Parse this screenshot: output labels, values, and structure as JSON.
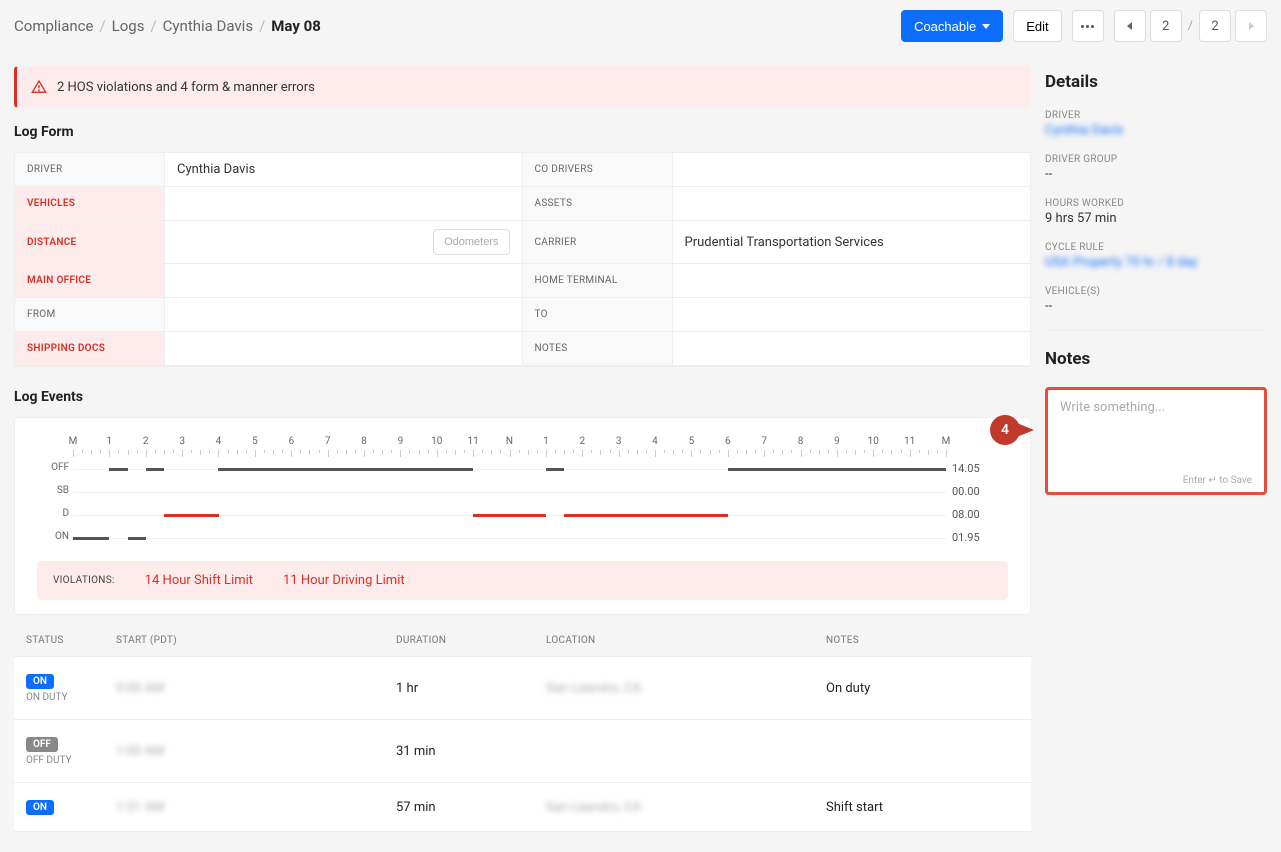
{
  "breadcrumbs": [
    "Compliance",
    "Logs",
    "Cynthia Davis",
    "May 08"
  ],
  "top_actions": {
    "primary": "Coachable",
    "edit": "Edit",
    "page_current": "2",
    "page_total": "2"
  },
  "alert": "2 HOS violations and 4 form & manner errors",
  "sections": {
    "log_form": "Log Form",
    "log_events": "Log Events"
  },
  "form": {
    "rows": [
      {
        "l": "DRIVER",
        "lv": "Cynthia Davis",
        "le": false,
        "r": "CO DRIVERS",
        "rv": "",
        "re": false
      },
      {
        "l": "VEHICLES",
        "lv": "",
        "le": true,
        "r": "ASSETS",
        "rv": "",
        "re": false
      },
      {
        "l": "DISTANCE",
        "lv": "",
        "le": true,
        "odo": "Odometers",
        "r": "CARRIER",
        "rv": "Prudential Transportation Services",
        "re": false
      },
      {
        "l": "MAIN OFFICE",
        "lv": "",
        "le": true,
        "r": "HOME TERMINAL",
        "rv": "",
        "re": false
      },
      {
        "l": "FROM",
        "lv": "",
        "le": false,
        "r": "TO",
        "rv": "",
        "re": false
      },
      {
        "l": "SHIPPING DOCS",
        "lv": "",
        "le": true,
        "r": "NOTES",
        "rv": "",
        "re": false
      }
    ]
  },
  "chart_data": {
    "type": "line",
    "x_labels": [
      "M",
      "1",
      "2",
      "3",
      "4",
      "5",
      "6",
      "7",
      "8",
      "9",
      "10",
      "11",
      "N",
      "1",
      "2",
      "3",
      "4",
      "5",
      "6",
      "7",
      "8",
      "9",
      "10",
      "11",
      "M"
    ],
    "rows": [
      "OFF",
      "SB",
      "D",
      "ON"
    ],
    "totals": {
      "OFF": "14.05",
      "SB": "00.00",
      "D": "08.00",
      "ON": "01.95"
    },
    "segments": [
      {
        "status": "ON",
        "start": 0.0,
        "end": 1.0,
        "color": "gray"
      },
      {
        "status": "OFF",
        "start": 1.0,
        "end": 1.5,
        "color": "gray"
      },
      {
        "status": "ON",
        "start": 1.5,
        "end": 2.0,
        "color": "gray"
      },
      {
        "status": "OFF",
        "start": 2.0,
        "end": 2.5,
        "color": "gray"
      },
      {
        "status": "D",
        "start": 2.5,
        "end": 4.0,
        "color": "red"
      },
      {
        "status": "OFF",
        "start": 4.0,
        "end": 11.0,
        "color": "gray"
      },
      {
        "status": "D",
        "start": 11.0,
        "end": 13.0,
        "color": "red"
      },
      {
        "status": "OFF",
        "start": 13.0,
        "end": 13.5,
        "color": "gray"
      },
      {
        "status": "D",
        "start": 13.5,
        "end": 18.0,
        "color": "red"
      },
      {
        "status": "OFF",
        "start": 18.0,
        "end": 24.0,
        "color": "gray"
      }
    ]
  },
  "violations": {
    "label": "VIOLATIONS:",
    "items": [
      "14 Hour Shift Limit",
      "11 Hour Driving Limit"
    ]
  },
  "events": {
    "headers": [
      "STATUS",
      "START (PDT)",
      "DURATION",
      "LOCATION",
      "NOTES"
    ],
    "rows": [
      {
        "badge": "ON",
        "badge_cls": "on",
        "sub": "ON DUTY",
        "start": "0:00 AM",
        "duration": "1 hr",
        "location": "San Leandro, CA",
        "notes": "On duty"
      },
      {
        "badge": "OFF",
        "badge_cls": "off",
        "sub": "OFF DUTY",
        "start": "1:00 AM",
        "duration": "31 min",
        "location": "",
        "notes": ""
      },
      {
        "badge": "ON",
        "badge_cls": "on",
        "sub": "",
        "start": "1:31 AM",
        "duration": "57 min",
        "location": "San Leandro, CA",
        "notes": "Shift start"
      }
    ]
  },
  "details": {
    "title": "Details",
    "driver_label": "DRIVER",
    "driver_value": "Cynthia Davis",
    "group_label": "DRIVER GROUP",
    "group_value": "--",
    "hours_label": "HOURS WORKED",
    "hours_value": "9 hrs 57 min",
    "cycle_label": "CYCLE RULE",
    "cycle_value": "USA Property 70 hr / 8 day",
    "vehicles_label": "VEHICLE(S)",
    "vehicles_value": "--"
  },
  "notes": {
    "title": "Notes",
    "placeholder": "Write something...",
    "save_hint": "Enter ↵ to Save",
    "callout": "4"
  }
}
